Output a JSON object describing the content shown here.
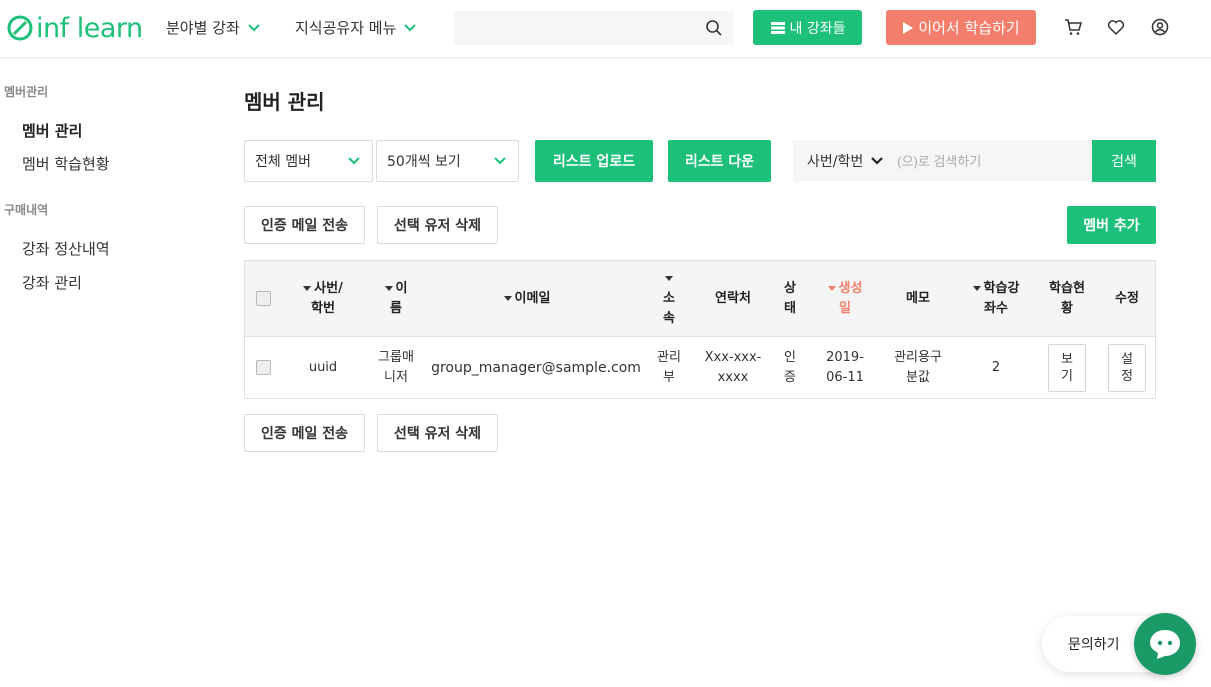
{
  "header": {
    "logo_text": "inf learn",
    "nav": [
      {
        "label": "분야별 강좌"
      },
      {
        "label": "지식공유자 메뉴"
      }
    ],
    "search_placeholder": "",
    "my_courses_label": "내 강좌들",
    "continue_label": "이어서 학습하기"
  },
  "sidebar": {
    "groups": [
      {
        "title": "멤버관리",
        "items": [
          {
            "label": "멤버 관리"
          },
          {
            "label": "멤버 학습현황"
          }
        ]
      },
      {
        "title": "구매내역",
        "items": [
          {
            "label": "강좌 정산내역"
          },
          {
            "label": "강좌 관리"
          }
        ]
      }
    ]
  },
  "main": {
    "title": "멤버 관리",
    "filter_member": "전체 멤버",
    "filter_page_size": "50개씩 보기",
    "upload_label": "리스트 업로드",
    "download_label": "리스트 다운",
    "search_field": "사번/학번",
    "search_placeholder": "(으)로 검색하기",
    "search_button": "검색",
    "send_mail_label": "인증 메일 전송",
    "delete_label": "선택 유저 삭제",
    "add_member_label": "멤버 추가"
  },
  "table": {
    "headers": {
      "id": [
        "사번/",
        "학번"
      ],
      "name": [
        "이",
        "름"
      ],
      "email": "이메일",
      "affiliation": [
        "소",
        "속"
      ],
      "contact": "연락처",
      "status": [
        "상",
        "태"
      ],
      "created": [
        "생성",
        "일"
      ],
      "memo": "메모",
      "course_count": [
        "학습강",
        "좌수"
      ],
      "progress": [
        "학습현",
        "황"
      ],
      "edit": "수정"
    },
    "rows": [
      {
        "id": "uuid",
        "name": [
          "그룹매",
          "니저"
        ],
        "email": "group_manager@sample.com",
        "affiliation": [
          "관리",
          "부"
        ],
        "contact": [
          "Xxx-xxx-",
          "xxxx"
        ],
        "status": [
          "인",
          "증"
        ],
        "created": [
          "2019-",
          "06-11"
        ],
        "memo": [
          "관리용구",
          "분값"
        ],
        "course_count": "2",
        "view_label": [
          "보",
          "기"
        ],
        "settings_label": [
          "설",
          "정"
        ]
      }
    ]
  },
  "chat": {
    "label": "문의하기"
  },
  "colors": {
    "brand": "#1dc078",
    "accent": "#f37e6c"
  }
}
